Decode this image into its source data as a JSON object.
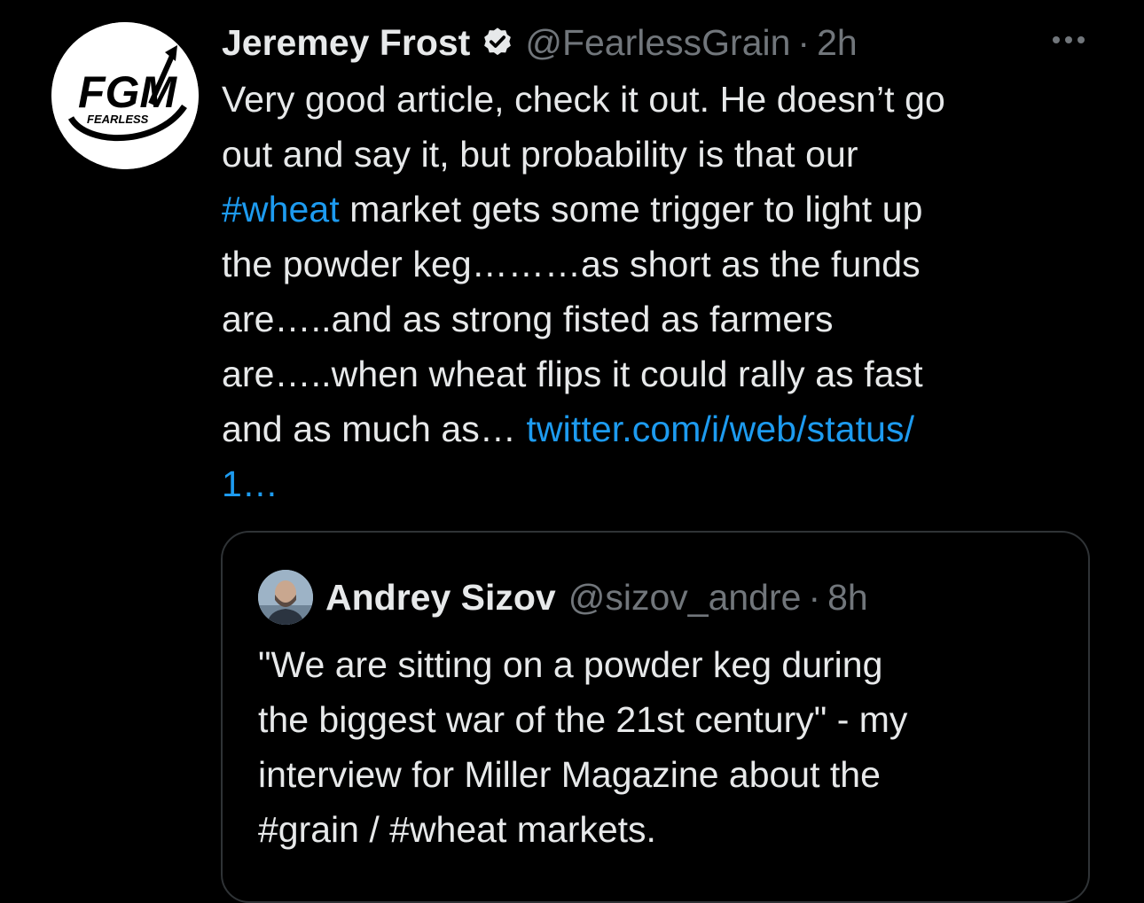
{
  "tweet": {
    "author_name": "Jeremey Frost",
    "author_handle": "@FearlessGrain",
    "separator": "·",
    "time": "2h",
    "verified": true,
    "avatar_logo_text": "FGM",
    "avatar_logo_subtext": "FEARLESS",
    "more_icon": "more-horizontal-icon",
    "text_line_1": "Very good article, check it out.  He doesn’t go",
    "text_line_2": "out and say it, but probability is that our",
    "hashtag_wheat": "#wheat",
    "text_line_3_rest": " market gets some trigger to light up",
    "text_line_4": "the powder keg………as short as the funds",
    "text_line_5": "are…..and as strong fisted as farmers",
    "text_line_6": "are…..when wheat flips it could rally as fast",
    "text_line_7_start": "and as much as… ",
    "link_line_1": "twitter.com/i/web/status/",
    "link_line_2": "1…"
  },
  "quoted_tweet": {
    "author_name": "Andrey Sizov",
    "author_handle": "@sizov_andre",
    "separator": "·",
    "time": "8h",
    "text_line_1": "\"We are sitting on a powder keg during",
    "text_line_2": "the biggest war of the 21st century\" - my",
    "text_line_3": "interview for Miller Magazine about the",
    "text_line_4": "#grain / #wheat markets."
  },
  "colors": {
    "background": "#000000",
    "text_primary": "#e7e9ea",
    "text_secondary": "#71767b",
    "link": "#1d9bf0",
    "border": "#2f3336"
  }
}
